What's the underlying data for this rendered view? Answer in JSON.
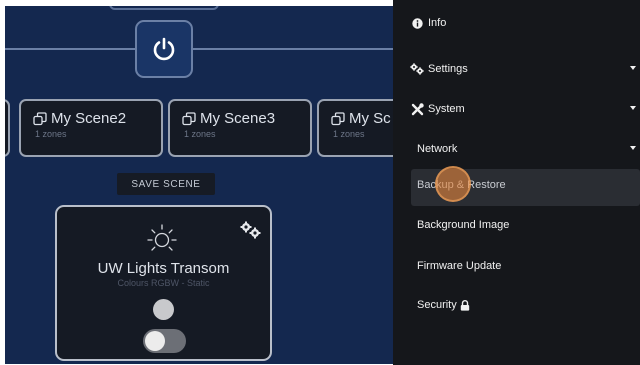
{
  "scenes": [
    {
      "title": "",
      "subtitle": ""
    },
    {
      "title": "My Scene2",
      "subtitle": "1 zones"
    },
    {
      "title": "My Scene3",
      "subtitle": "1 zones"
    },
    {
      "title": "My Sc",
      "subtitle": "1 zones"
    }
  ],
  "save_scene_label": "SAVE SCENE",
  "zone": {
    "title": "UW Lights Transom",
    "subtitle": "Colours RGBW - Static",
    "switch_on": false
  },
  "menu": {
    "info": "Info",
    "settings": "Settings",
    "system": "System",
    "network": "Network",
    "backup_restore": "Backup & Restore",
    "background_image": "Background Image",
    "firmware_update": "Firmware Update",
    "security": "Security"
  },
  "colors": {
    "app_background": "#14284f",
    "menu_background": "#15171b",
    "click_indicator": "#e2843e"
  }
}
